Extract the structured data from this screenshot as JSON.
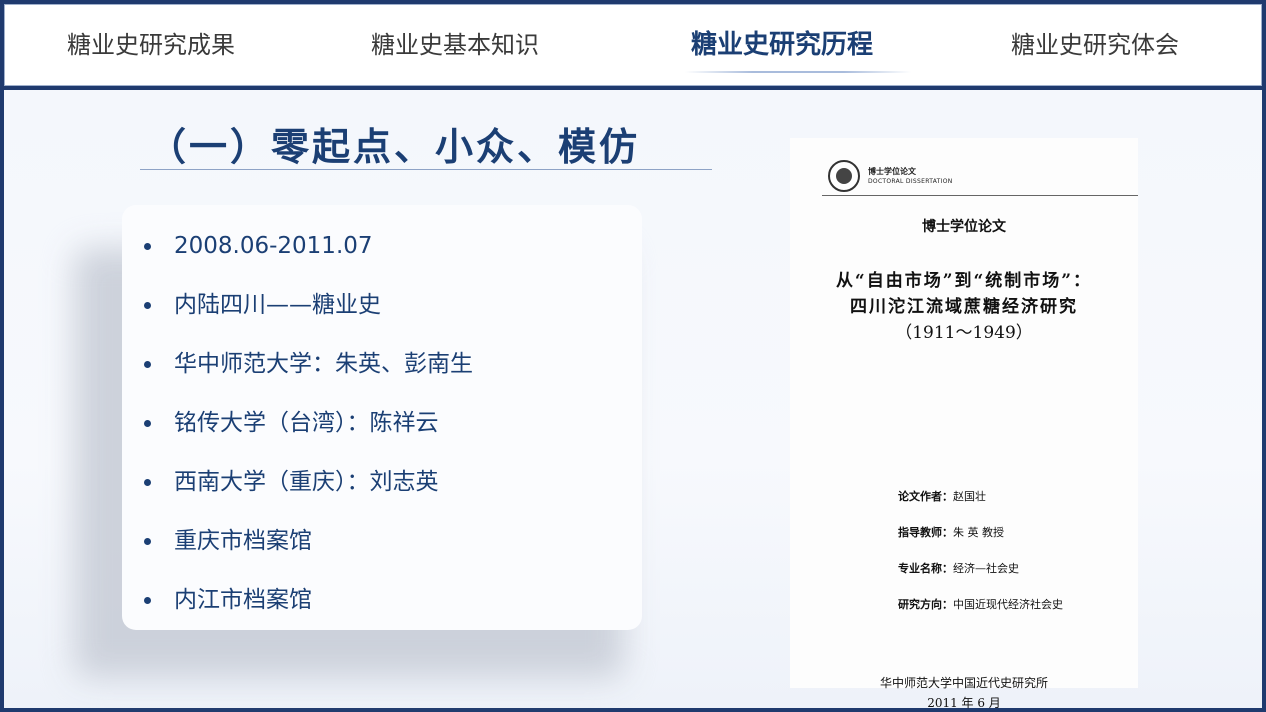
{
  "nav": {
    "items": [
      {
        "label": "糖业史研究成果",
        "active": false
      },
      {
        "label": "糖业史基本知识",
        "active": false
      },
      {
        "label": "糖业史研究历程",
        "active": true
      },
      {
        "label": "糖业史研究体会",
        "active": false
      }
    ]
  },
  "main": {
    "title": "（一）零起点、小众、模仿",
    "bullets": [
      "2008.06-2011.07",
      "内陆四川——糖业史",
      "华中师范大学：朱英、彭南生",
      "铭传大学（台湾）：陈祥云",
      "西南大学（重庆）：刘志英",
      "重庆市档案馆",
      "内江市档案馆"
    ]
  },
  "document": {
    "header_cn": "博士学位论文",
    "header_en": "DOCTORAL DISSERTATION",
    "label": "博士学位论文",
    "title_line1": "从“自由市场”到“统制市场”：",
    "title_line2": "四川沱江流域蔗糖经济研究",
    "years": "（1911～1949）",
    "fields": [
      {
        "key": "论文作者：",
        "value": "赵国壮"
      },
      {
        "key": "指导教师：",
        "value": "朱 英 教授"
      },
      {
        "key": "专业名称：",
        "value": "经济—社会史"
      },
      {
        "key": "研究方向：",
        "value": "中国近现代经济社会史"
      }
    ],
    "institution": "华中师范大学中国近代史研究所",
    "date": "2011 年 6 月"
  },
  "colors": {
    "frame": "#1f3a6e",
    "accent": "#1b3f74",
    "nav_text": "#3a3a3a"
  }
}
